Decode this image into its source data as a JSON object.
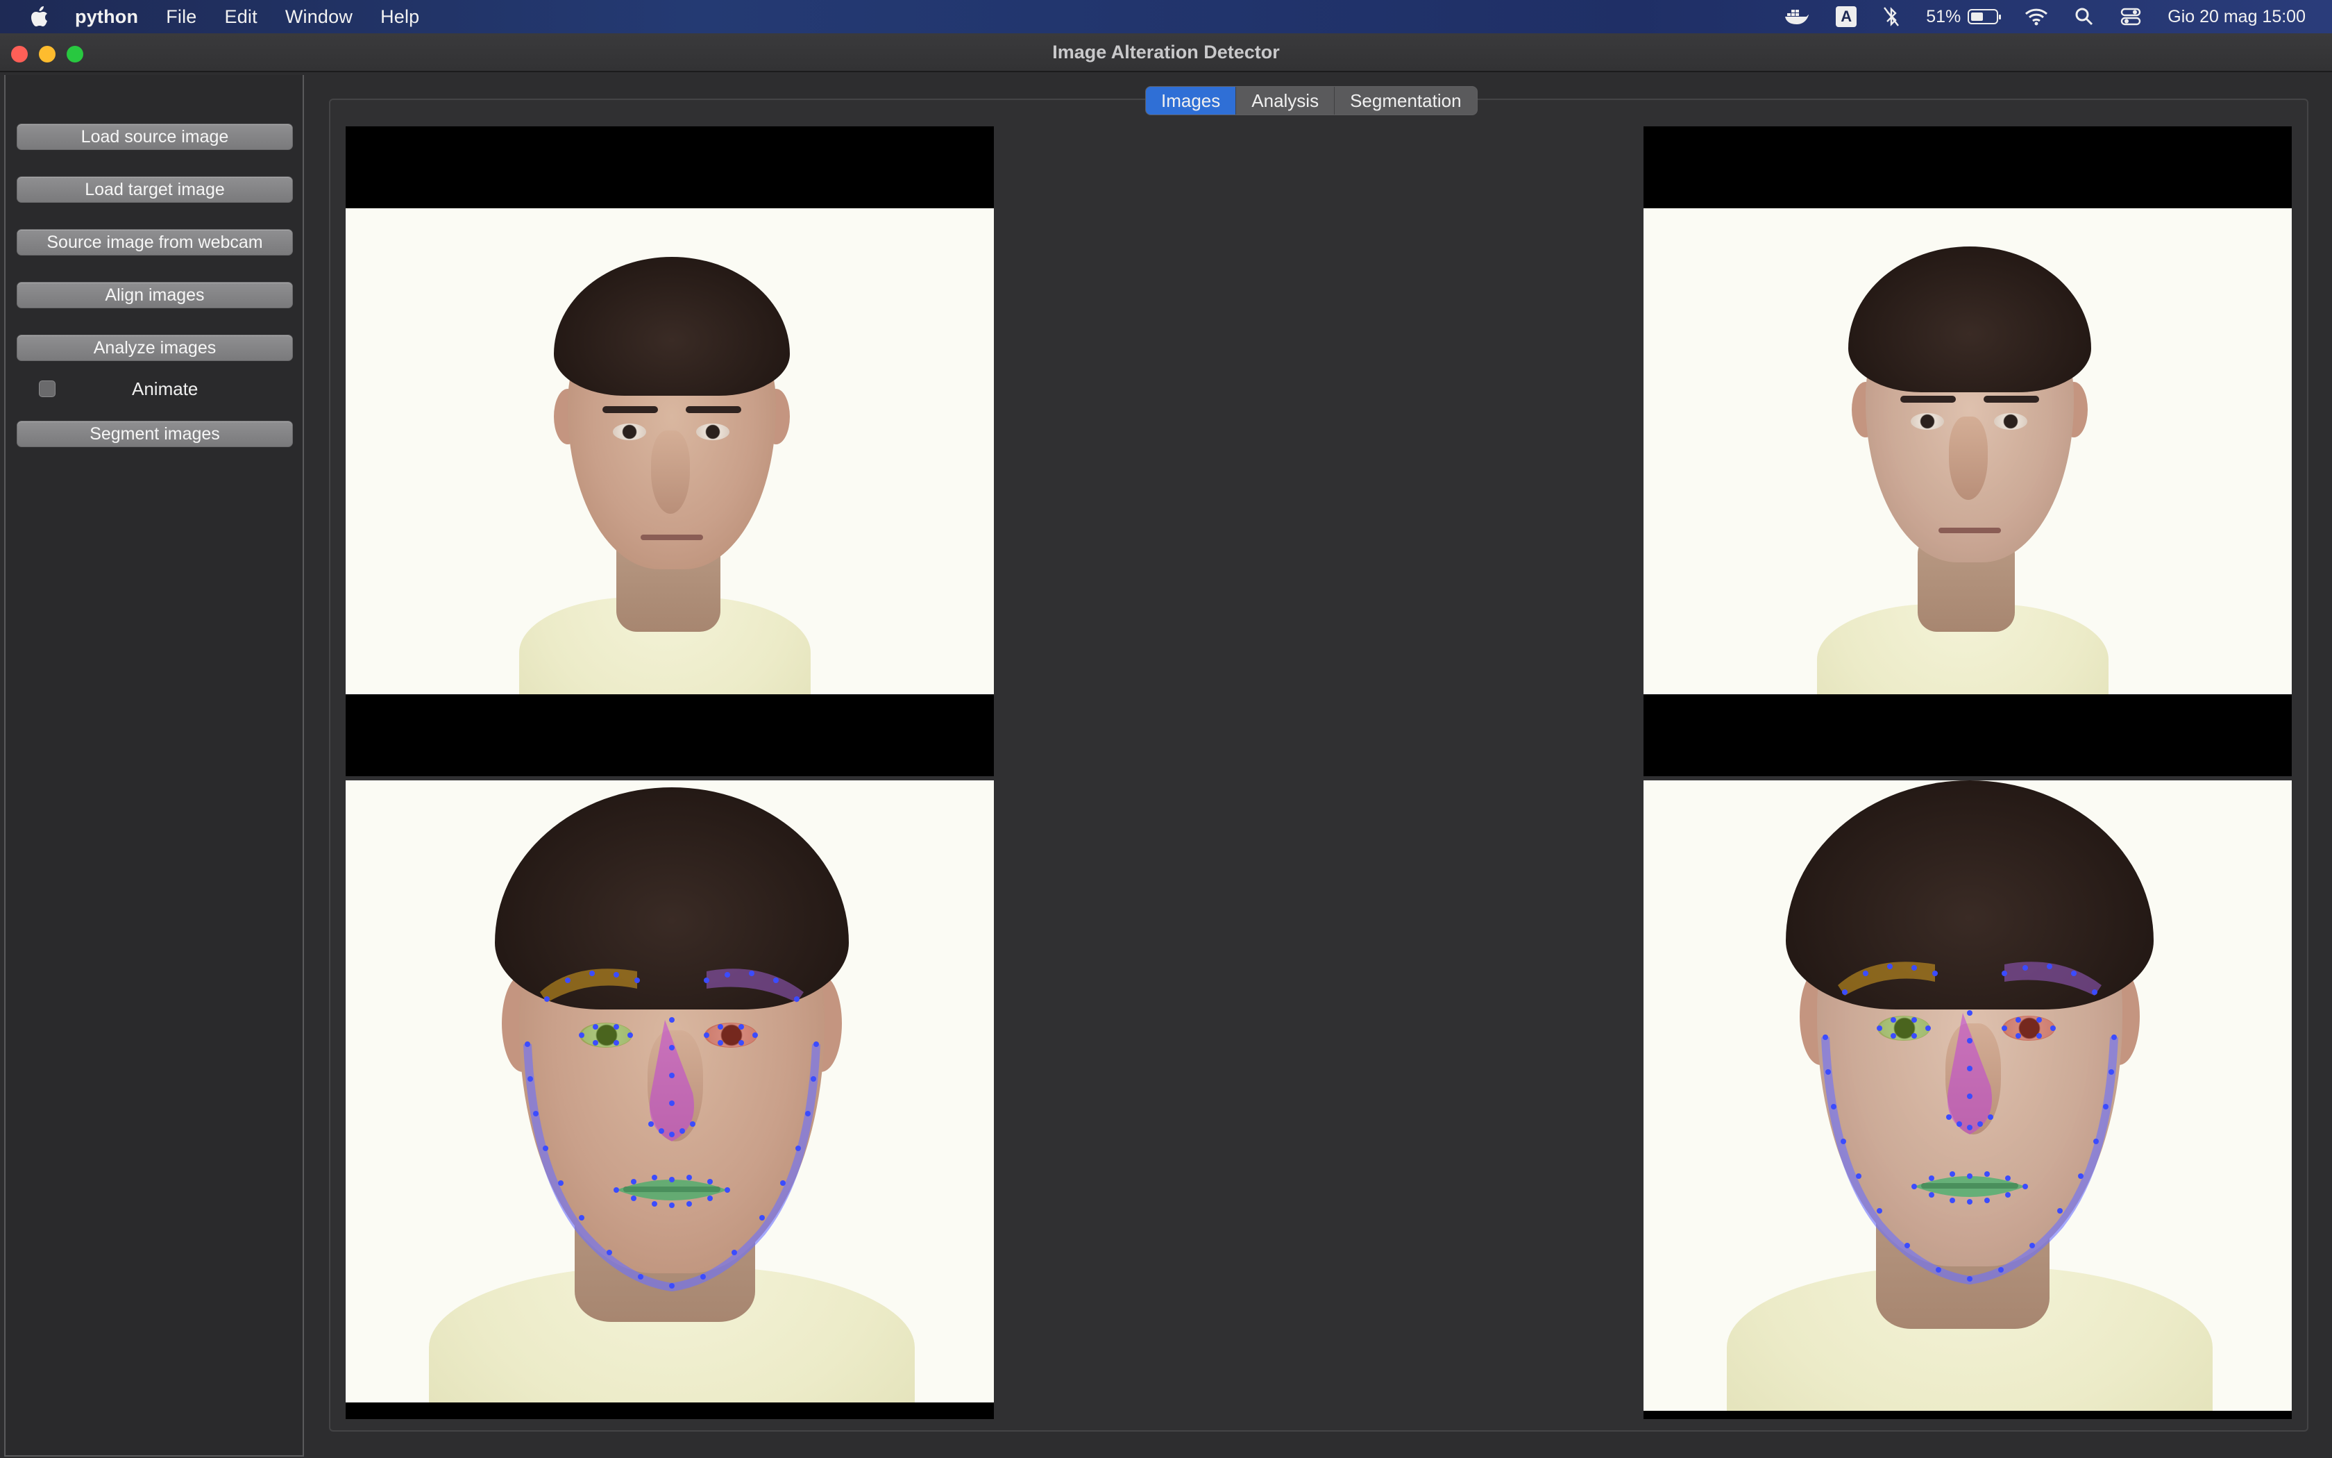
{
  "menubar": {
    "app": "python",
    "items": [
      "File",
      "Edit",
      "Window",
      "Help"
    ],
    "battery": "51%",
    "battery_level": 0.51,
    "datetime": "Gio 20 mag  15:00",
    "input_source": "A"
  },
  "window": {
    "title": "Image Alteration Detector"
  },
  "sidebar": {
    "buttons": {
      "load_source": "Load source image",
      "load_target": "Load target image",
      "webcam": "Source image from webcam",
      "align": "Align images",
      "analyze": "Analyze images",
      "segment": "Segment images"
    },
    "animate_label": "Animate",
    "animate_checked": false
  },
  "tabs": {
    "images": "Images",
    "analysis": "Analysis",
    "segmentation": "Segmentation",
    "active": "Images"
  },
  "colors": {
    "tab_active": "#2f6fd6",
    "landmark_points": "#3b4cff",
    "brow_left_overlay": "#d9a020",
    "brow_right_overlay": "#9b5cc8",
    "nose_overlay": "#c040d8",
    "lips_overlay": "#20b060"
  }
}
